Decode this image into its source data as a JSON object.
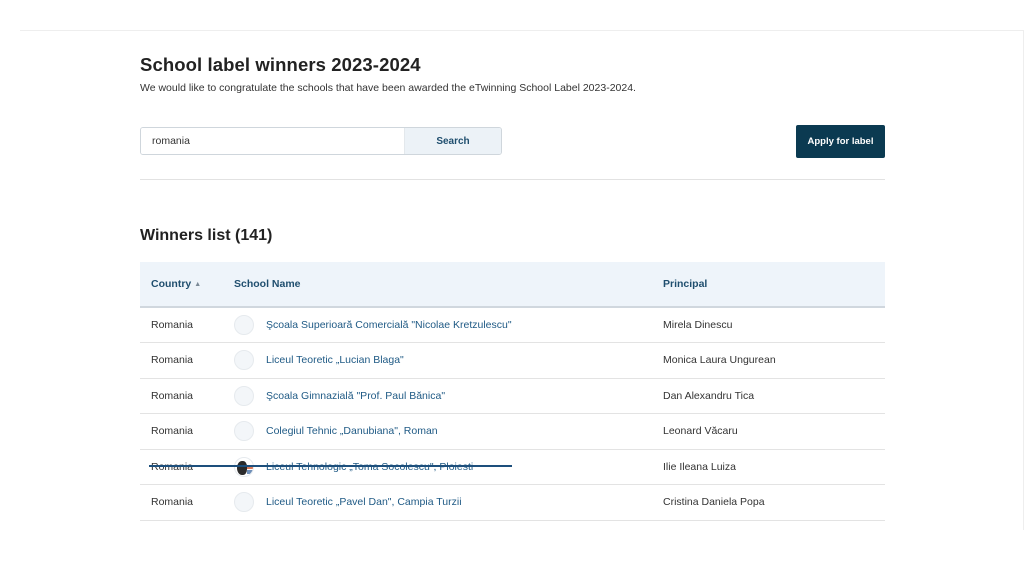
{
  "header": {
    "title": "School label winners 2023-2024",
    "subtitle": "We would like to congratulate the schools that have been awarded the eTwinning School Label 2023-2024."
  },
  "search": {
    "value": "romania",
    "button_label": "Search"
  },
  "apply_button_label": "Apply for label",
  "winners": {
    "title": "Winners list (141)",
    "columns": {
      "country": "Country",
      "school": "School Name",
      "principal": "Principal"
    },
    "sort_indicator": "▲",
    "rows": [
      {
        "country": "Romania",
        "school": "Şcoala Superioară Comercială \"Nicolae Kretzulescu\"",
        "principal": "Mirela Dinescu",
        "logo": "placeholder"
      },
      {
        "country": "Romania",
        "school": "Liceul Teoretic „Lucian Blaga\"",
        "principal": "Monica Laura Ungurean",
        "logo": "placeholder"
      },
      {
        "country": "Romania",
        "school": "Şcoala Gimnazială \"Prof. Paul Bănica\"",
        "principal": "Dan Alexandru Tica",
        "logo": "placeholder"
      },
      {
        "country": "Romania",
        "school": "Colegiul Tehnic „Danubiana\", Roman",
        "principal": "Leonard Văcaru",
        "logo": "placeholder"
      },
      {
        "country": "Romania",
        "school": "Liceul Tehnologic „Toma Socolescu\", Ploiesti",
        "principal": "Ilie Ileana Luiza",
        "logo": "photo"
      },
      {
        "country": "Romania",
        "school": "Liceul Teoretic „Pavel Dan\", Campia Turzii",
        "principal": "Cristina Daniela Popa",
        "logo": "placeholder"
      }
    ]
  }
}
